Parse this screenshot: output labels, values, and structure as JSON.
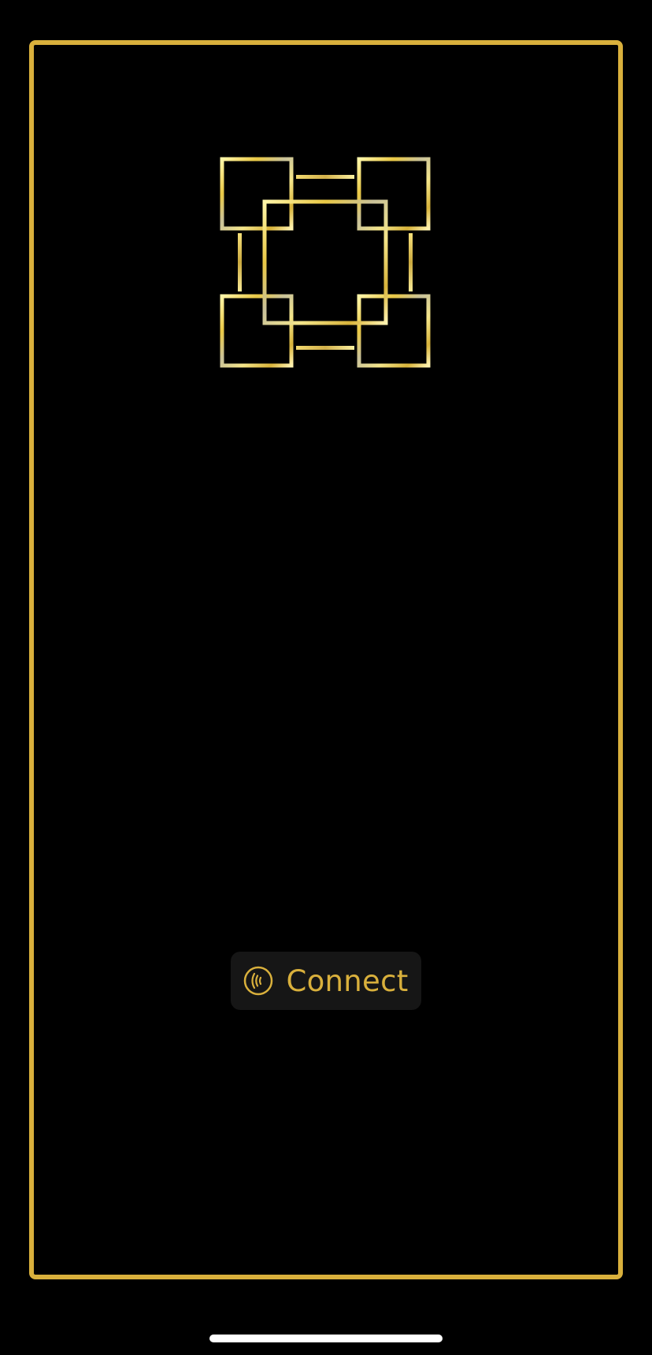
{
  "app": {
    "logo_icon": "linked-squares-logo-icon",
    "accent_color": "#d9b03c",
    "background_color": "#000000"
  },
  "connect": {
    "label": "Connect",
    "icon": "contactless-signal-icon"
  }
}
